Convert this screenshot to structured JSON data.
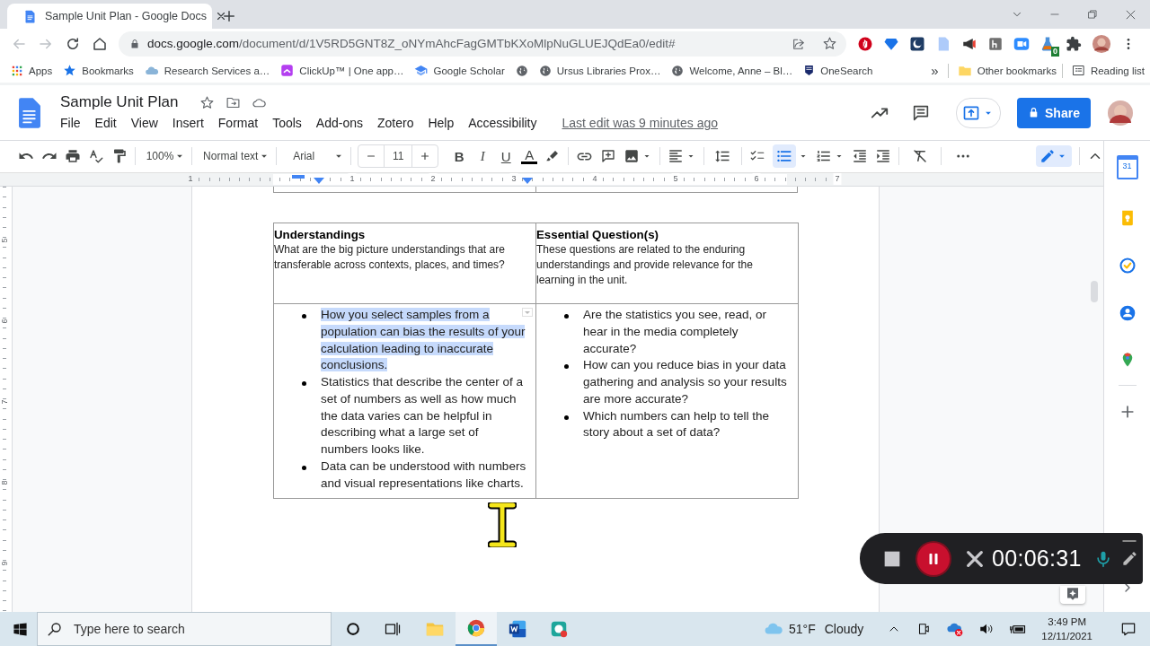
{
  "browser": {
    "tab_title": "Sample Unit Plan - Google Docs",
    "url_host": "docs.google.com",
    "url_path": "/document/d/1V5RD5GNT8Z_oNYmAhcFagGMTbKXoMlpNuGLUEJQdEa0/edit#",
    "extension_badge": "0",
    "bookmarks": [
      {
        "label": "Apps",
        "kind": "apps"
      },
      {
        "label": "Bookmarks",
        "kind": "star"
      },
      {
        "label": "Research Services a…",
        "kind": "cloud"
      },
      {
        "label": "ClickUp™ | One app…",
        "kind": "clickup"
      },
      {
        "label": "Google Scholar",
        "kind": "scholar"
      },
      {
        "kind": "globe"
      },
      {
        "label": "Ursus Libraries Prox…",
        "kind": "globe"
      },
      {
        "label": "Welcome, Anne – Bl…",
        "kind": "globe"
      },
      {
        "label": "OneSearch",
        "kind": "shield"
      }
    ],
    "overflow": "»",
    "other_bookmarks": "Other bookmarks",
    "reading_list": "Reading list"
  },
  "doc": {
    "title": "Sample Unit Plan",
    "menus": [
      "File",
      "Edit",
      "View",
      "Insert",
      "Format",
      "Tools",
      "Add-ons",
      "Zotero",
      "Help",
      "Accessibility"
    ],
    "last_edit": "Last edit was 9 minutes ago",
    "share": "Share"
  },
  "toolbar": {
    "zoom": "100%",
    "style": "Normal text",
    "font": "Arial",
    "font_size": "11",
    "format_marks": [
      "B",
      "I",
      "U",
      "A"
    ],
    "bulleted_list_on": true,
    "editing_mode_on": true
  },
  "ruler": {
    "horizontal_labels": [
      "1",
      "1",
      "2",
      "3",
      "4",
      "5",
      "6",
      "7"
    ],
    "vertical_labels": [
      "5",
      "6",
      "7",
      "8",
      "9"
    ]
  },
  "table": {
    "headers": [
      {
        "title": "Understandings",
        "description": "What are the big picture understandings that are transferable across contexts, places, and times?"
      },
      {
        "title": "Essential Question(s)",
        "description": "These questions are related to the enduring understandings and provide relevance for the learning in the unit."
      }
    ],
    "cells": [
      {
        "bullets": [
          {
            "text": "How you select samples from a population can bias the results of your calculation leading to inaccurate conclusions.",
            "highlighted": true
          },
          {
            "text": "Statistics that describe the center of a set of numbers as well as how much the data varies can be helpful in describing what a large set of numbers looks like.",
            "highlighted": false
          },
          {
            "text": "Data can be understood with numbers and visual representations like charts.",
            "highlighted": false
          }
        ]
      },
      {
        "bullets": [
          {
            "text": "Are the statistics you see, read, or hear in the media completely accurate?",
            "highlighted": false
          },
          {
            "text": "How can you reduce bias in your data gathering and analysis so your results are more accurate?",
            "highlighted": false
          },
          {
            "text": "Which numbers can help to tell the story about a set of data?",
            "highlighted": false
          }
        ]
      }
    ]
  },
  "side_panel": {
    "calendar_day": "31"
  },
  "recorder": {
    "time": "00:06:31"
  },
  "taskbar": {
    "search_placeholder": "Type here to search",
    "apps": [
      {
        "kind": "explorer",
        "active": false
      },
      {
        "kind": "chrome",
        "active": true
      },
      {
        "kind": "word",
        "active": false
      },
      {
        "kind": "recorder",
        "active": false
      }
    ],
    "temperature": "51°F",
    "weather": "Cloudy",
    "time": "3:49 PM",
    "date": "12/11/2021"
  }
}
